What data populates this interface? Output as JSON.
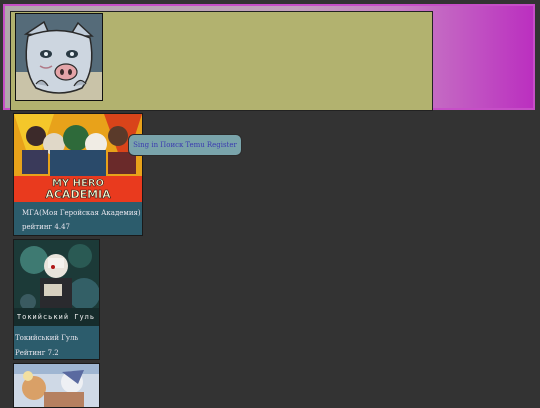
{
  "header": {
    "logo_name": "boar-mask-avatar-icon"
  },
  "nav": {
    "items": [
      "Sing in",
      "Поиск",
      "Temu",
      "Register"
    ]
  },
  "cards": [
    {
      "title_text": "MY HERO ACADEMIA",
      "title": "МГА(Моя Геройская Академия)",
      "rating": "рейтинг 4.47"
    },
    {
      "title_text": "Токийський Гуль",
      "title": "Токийський Гуль",
      "rating": "Рейтинг 7.2"
    },
    {
      "title": "",
      "rating": ""
    }
  ],
  "colors": {
    "page_bg": "#333333",
    "header_gradient_end": "#bb2fc0",
    "header_panel": "#b2b26f",
    "card_bg": "#2c5c6c",
    "nav_bg": "#7aa4ab",
    "nav_text": "#3b3bb0"
  }
}
